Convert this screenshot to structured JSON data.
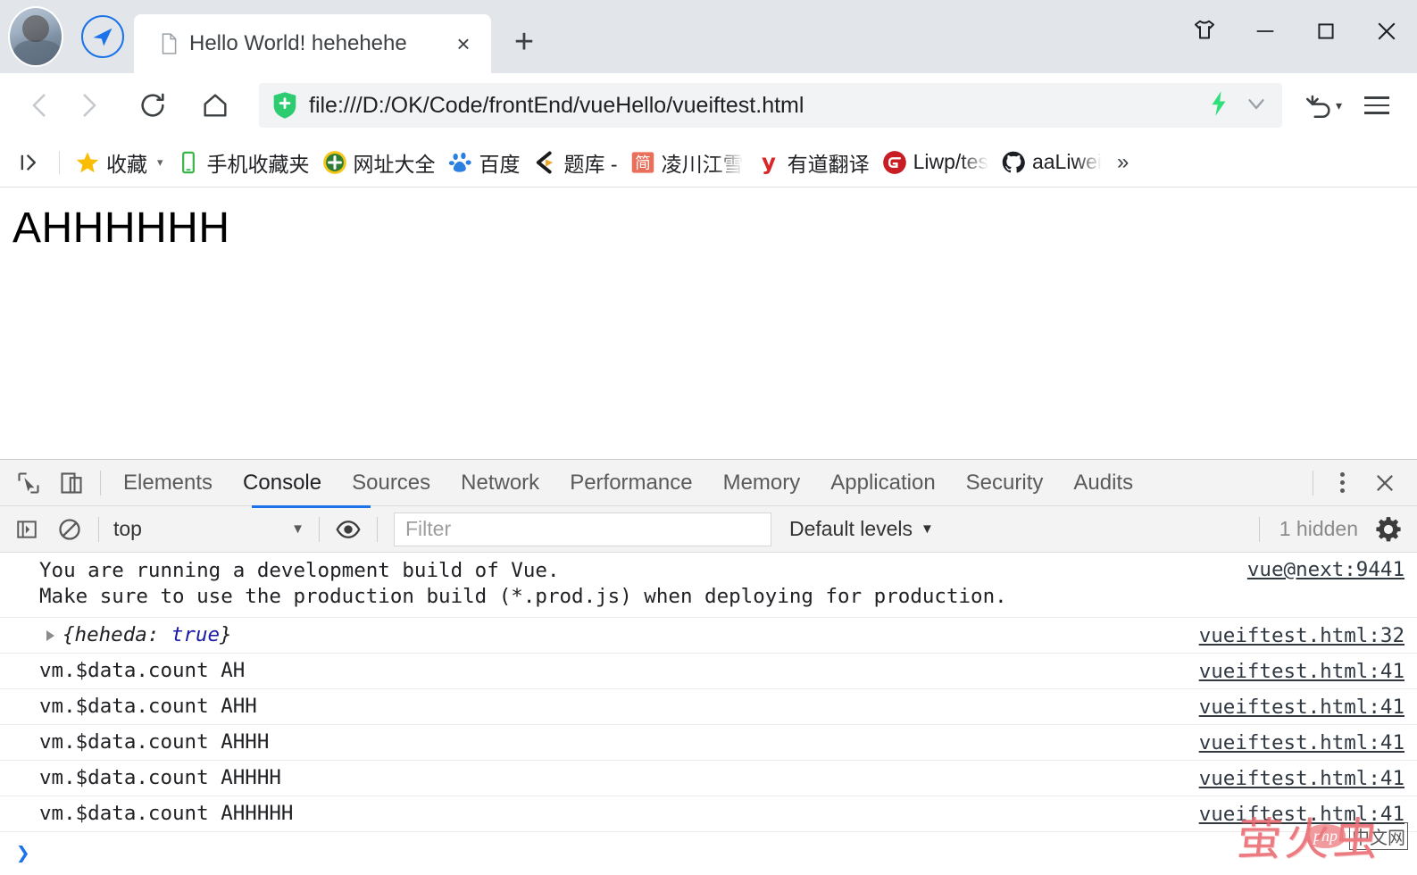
{
  "window": {
    "controls": [
      {
        "name": "skin-icon",
        "label": "Skin"
      },
      {
        "name": "minimize-button",
        "label": "Minimize"
      },
      {
        "name": "maximize-button",
        "label": "Maximize"
      },
      {
        "name": "close-button",
        "label": "Close"
      }
    ]
  },
  "tabstrip": {
    "tab": {
      "title": "Hello World! hehehehe",
      "close_label": "×"
    },
    "new_tab_label": "+"
  },
  "toolbar": {
    "back_label": "‹",
    "forward_label": "›",
    "reload_label": "reload",
    "home_label": "home",
    "url": "file:///D:/OK/Code/frontEnd/vueHello/vueiftest.html",
    "undo_label": "undo",
    "menu_label": "menu"
  },
  "bookmarks": {
    "apps_label": "apps",
    "items": [
      {
        "label": "收藏",
        "icon": "star-icon",
        "caret": "▾"
      },
      {
        "label": "手机收藏夹",
        "icon": "phone-icon"
      },
      {
        "label": "网址大全",
        "icon": "hao123-icon"
      },
      {
        "label": "百度",
        "icon": "baidu-icon"
      },
      {
        "label": "题库 -",
        "icon": "tiku-icon"
      },
      {
        "label": "凌川江雪",
        "icon": "jianshu-icon",
        "fade": true
      },
      {
        "label": "有道翻译",
        "icon": "youdao-icon"
      },
      {
        "label": "Liwp/tes",
        "icon": "gitee-icon",
        "fade": true
      },
      {
        "label": "aaLiwei",
        "icon": "github-icon",
        "fade": true
      }
    ],
    "overflow_label": "»"
  },
  "page": {
    "heading": "AHHHHHH"
  },
  "devtools": {
    "inspect_label": "inspect",
    "device_label": "device-toolbar",
    "tabs": [
      {
        "label": "Elements",
        "active": false
      },
      {
        "label": "Console",
        "active": true
      },
      {
        "label": "Sources",
        "active": false
      },
      {
        "label": "Network",
        "active": false
      },
      {
        "label": "Performance",
        "active": false
      },
      {
        "label": "Memory",
        "active": false
      },
      {
        "label": "Application",
        "active": false
      },
      {
        "label": "Security",
        "active": false
      },
      {
        "label": "Audits",
        "active": false
      }
    ],
    "more_label": "⋮",
    "close_label": "×",
    "filterbar": {
      "sidebar_label": "console-sidebar",
      "clear_label": "clear-console",
      "context": "top",
      "context_caret": "▼",
      "eye_label": "live-expression",
      "filter_placeholder": "Filter",
      "levels": "Default levels",
      "levels_caret": "▼",
      "hidden": "1 hidden",
      "settings_label": "settings"
    },
    "console": {
      "messages": [
        {
          "text": "You are running a development build of Vue.\nMake sure to use the production build (*.prod.js) when deploying for production.",
          "source": "vue@next:9441",
          "multiline": true,
          "disclosure": false,
          "indent": false
        },
        {
          "text": "{heheda: true}",
          "source": "vueiftest.html:32",
          "multiline": false,
          "disclosure": true,
          "indent": true,
          "object": true
        },
        {
          "text": "vm.$data.count AH",
          "source": "vueiftest.html:41",
          "multiline": false,
          "disclosure": false,
          "indent": false
        },
        {
          "text": "vm.$data.count AHH",
          "source": "vueiftest.html:41",
          "multiline": false,
          "disclosure": false,
          "indent": false
        },
        {
          "text": "vm.$data.count AHHH",
          "source": "vueiftest.html:41",
          "multiline": false,
          "disclosure": false,
          "indent": false
        },
        {
          "text": "vm.$data.count AHHHH",
          "source": "vueiftest.html:41",
          "multiline": false,
          "disclosure": false,
          "indent": false
        },
        {
          "text": "vm.$data.count AHHHHH",
          "source": "vueiftest.html:41",
          "multiline": false,
          "disclosure": false,
          "indent": false
        }
      ],
      "prompt_caret": "❯",
      "prompt_value": ""
    }
  },
  "watermark": {
    "cn": "萤火虫",
    "php": "php",
    "tag": "中文网"
  },
  "colors": {
    "accent": "#1a73e8",
    "tabstrip_bg": "#e2e6ea",
    "devtools_bg": "#f3f3f3",
    "link": "#303942",
    "bool": "#1a1aa6",
    "watermark": "#e8646a"
  }
}
